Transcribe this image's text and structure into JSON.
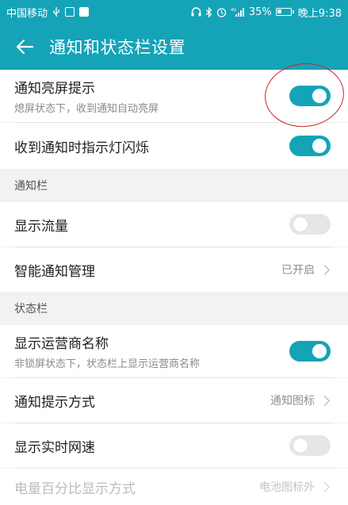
{
  "status_bar": {
    "carrier": "中国移动",
    "battery_percent": "35%",
    "time": "晚上9:38",
    "battery_level": 0.35,
    "icons": [
      "usb-icon",
      "app-notification-icon",
      "shield-app-icon",
      "headphones-icon",
      "bluetooth-icon",
      "alarm-icon",
      "signal-icon",
      "battery-icon"
    ]
  },
  "app_bar": {
    "title": "通知和状态栏设置",
    "back_icon": "arrow-left-icon"
  },
  "settings": {
    "screen_wake": {
      "title": "通知亮屏提示",
      "subtitle": "熄屏状态下，收到通知自动亮屏",
      "enabled": true
    },
    "indicator_light": {
      "title": "收到通知时指示灯闪烁",
      "enabled": true
    },
    "notification_section": {
      "header": "通知栏",
      "show_traffic": {
        "title": "显示流量",
        "enabled": false
      },
      "smart_notification": {
        "title": "智能通知管理",
        "value": "已开启"
      }
    },
    "status_section": {
      "header": "状态栏",
      "carrier_name": {
        "title": "显示运营商名称",
        "subtitle": "非锁屏状态下，状态栏上显示运营商名称",
        "enabled": true
      },
      "notify_style": {
        "title": "通知提示方式",
        "value": "通知图标"
      },
      "net_speed": {
        "title": "显示实时网速",
        "enabled": false
      },
      "battery_style": {
        "title": "电量百分比显示方式",
        "value": "电池图标外"
      }
    }
  },
  "colors": {
    "accent": "#15a3b8",
    "annotation": "#c8262a"
  }
}
